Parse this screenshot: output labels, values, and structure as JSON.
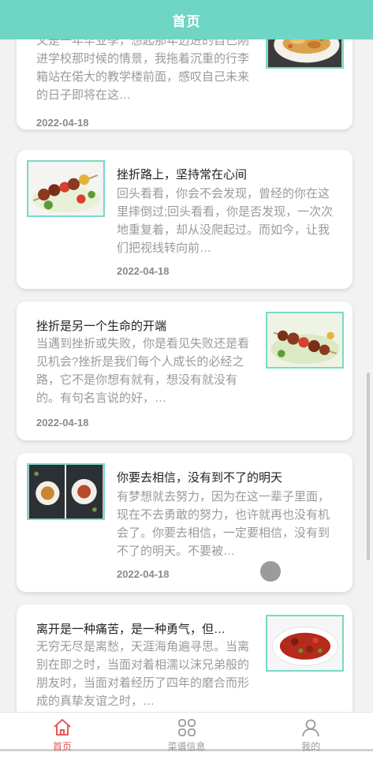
{
  "header": {
    "title": "首页"
  },
  "articles": [
    {
      "title": "",
      "excerpt": "又是一年毕业季，想起那年迈进的自己刚进学校那时候的情景，我拖着沉重的行李箱站在偌大的教学楼前面，感叹自己未来的日子即将在这…",
      "date": "2022-04-18",
      "image": "food-plate-image"
    },
    {
      "title": "挫折路上，坚持常在心间",
      "excerpt": "回头看看，你会不会发现，曾经的你在这里摔倒过;回头看看，你是否发现，一次次地重复着，却从没爬起过。而如今，让我们把视线转向前…",
      "date": "2022-04-18",
      "image": "skewer-food-image"
    },
    {
      "title": "挫折是另一个生命的开端",
      "excerpt": "当遇到挫折或失败，你是看见失败还是看见机会?挫折是我们每个人成长的必经之路，它不是你想有就有，想没有就没有的。有句名言说的好，…",
      "date": "2022-04-18",
      "image": "skewer-food-image"
    },
    {
      "title": "你要去相信，没有到不了的明天",
      "excerpt": "有梦想就去努力，因为在这一辈子里面，现在不去勇敢的努力，也许就再也没有机会了。你要去相信，一定要相信，没有到不了的明天。不要被…",
      "date": "2022-04-18",
      "image": "two-plates-image"
    },
    {
      "title": "离开是一种痛苦，是一种勇气，但…",
      "excerpt": "无穷无尽是离愁，天涯海角遍寻思。当离别在即之时，当面对着相濡以沫兄弟般的朋友时，当面对着经历了四年的磨合而形成的真挚友谊之时，…",
      "date": "",
      "image": "spicy-dish-image"
    }
  ],
  "tabbar": {
    "items": [
      {
        "label": "首页",
        "icon": "home-icon",
        "active": true
      },
      {
        "label": "菜谱信息",
        "icon": "grid-icon",
        "active": false
      },
      {
        "label": "我的",
        "icon": "user-icon",
        "active": false
      }
    ]
  },
  "colors": {
    "accent": "#6fd6c5",
    "active_tab": "#e35a5a",
    "thumb_border": "#7ad9c9"
  }
}
